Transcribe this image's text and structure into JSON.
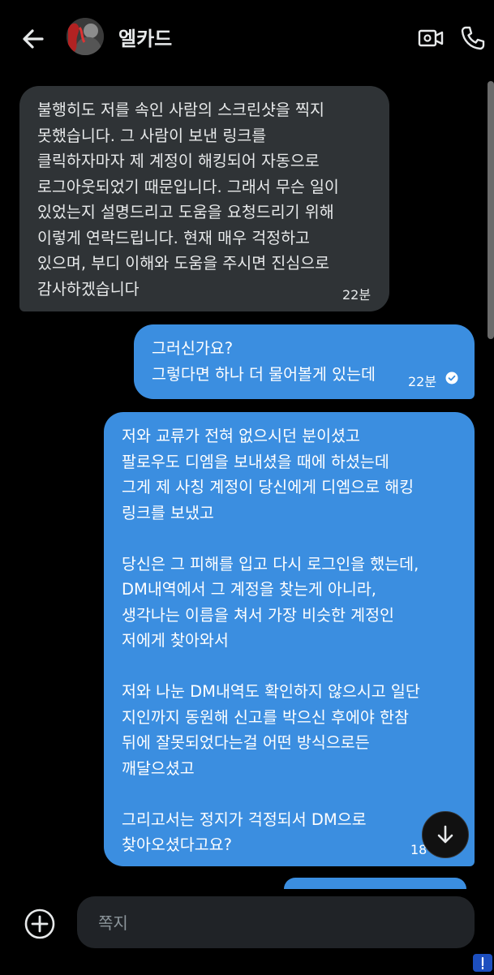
{
  "header": {
    "title": "엘카드",
    "back_icon": "arrow-left-icon",
    "video_icon": "video-camera-icon",
    "call_icon": "phone-icon"
  },
  "messages": [
    {
      "direction": "incoming",
      "text": "불행히도 저를 속인 사람의 스크린샷을 찍지\n못했습니다. 그 사람이 보낸 링크를\n클릭하자마자 제 계정이 해킹되어 자동으로\n로그아웃되었기 때문입니다. 그래서 무슨 일이\n있었는지 설명드리고 도움을 요청드리기 위해\n이렇게 연락드립니다. 현재 매우 걱정하고\n있으며, 부디 이해와 도움을 주시면 진심으로\n감사하겠습니다",
      "time": "22분"
    },
    {
      "direction": "outgoing",
      "text": "그러신가요?\n그렇다면 하나 더 물어볼게 있는데",
      "time": "22분",
      "status_icon": "check-circle-icon"
    },
    {
      "direction": "outgoing",
      "text": "저와 교류가 전혀 없으시던 분이셨고\n팔로우도 디엠을 보내셨을 때에 하셨는데\n그게 제 사칭 계정이 당신에게 디엠으로 해킹\n링크를 보냈고\n\n당신은 그 피해를 입고 다시 로그인을 했는데,\nDM내역에서 그 계정을 찾는게 아니라,\n생각나는 이름을 쳐서 가장 비슷한 계정인\n저에게 찾아와서\n\n저와 나눈 DM내역도 확인하지 않으시고 일단\n지인까지 동원해 신고를 박으신 후에야 한참\n뒤에 잘못되었다는걸 어떤 방식으로든\n깨달으셨고\n\n그리고서는 정지가 걱정되서 DM으로\n찾아오셨다고요?",
      "time": "18"
    }
  ],
  "scroll_down_icon": "arrow-down-icon",
  "composer": {
    "placeholder": "쪽지",
    "add_icon": "plus-circle-icon"
  },
  "colors": {
    "background": "#000000",
    "incoming_bubble": "#2f3336",
    "outgoing_bubble": "#3b8ee0",
    "composer_bg": "#202327"
  }
}
